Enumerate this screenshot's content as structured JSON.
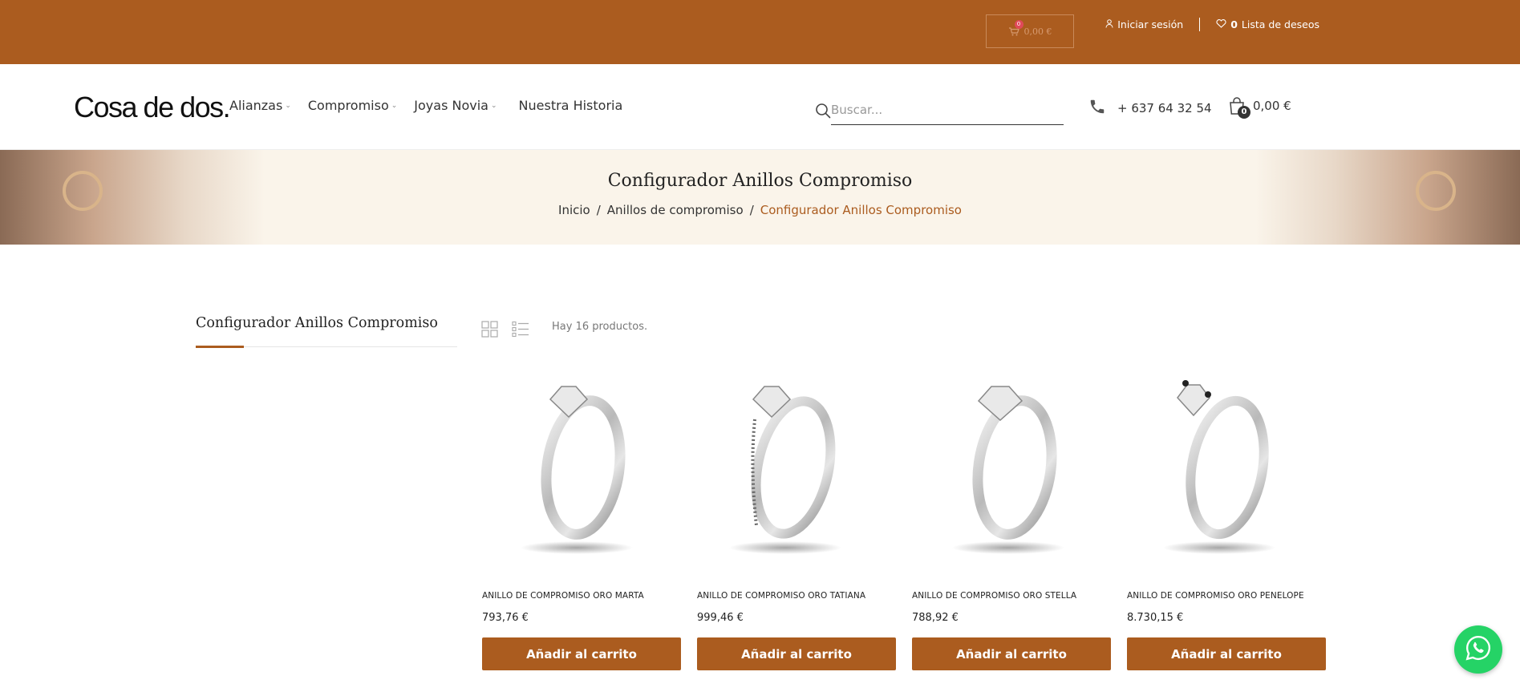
{
  "topbar": {
    "mini_cart_badge": "0",
    "mini_cart_amount": "0,00 €",
    "login_label": "Iniciar sesión",
    "wishlist_count": "0",
    "wishlist_label": "Lista de deseos"
  },
  "header": {
    "logo": "Cosa de dos.",
    "nav": [
      "Alianzas",
      "Compromiso",
      "Joyas Novia",
      "Nuestra Historia"
    ],
    "search_placeholder": "Buscar...",
    "phone": "+ 637 64 32 54",
    "cart_count": "0",
    "cart_amount": "0,00 €"
  },
  "banner": {
    "title": "Configurador Anillos Compromiso",
    "breadcrumb": [
      "Inicio",
      "Anillos de compromiso",
      "Configurador Anillos Compromiso"
    ]
  },
  "sidebar": {
    "title": "Configurador Anillos Compromiso"
  },
  "toolbar": {
    "count_text": "Hay 16 productos."
  },
  "products": [
    {
      "name": "ANILLO DE COMPROMISO ORO MARTA",
      "price": "793,76 €",
      "button": "Añadir al carrito"
    },
    {
      "name": "ANILLO DE COMPROMISO ORO TATIANA",
      "price": "999,46 €",
      "button": "Añadir al carrito"
    },
    {
      "name": "ANILLO DE COMPROMISO ORO STELLA",
      "price": "788,92 €",
      "button": "Añadir al carrito"
    },
    {
      "name": "ANILLO DE COMPROMISO ORO PENELOPE",
      "price": "8.730,15 €",
      "button": "Añadir al carrito"
    }
  ],
  "colors": {
    "brand": "#ab5c1f",
    "banner_bg": "#faf4ea",
    "whatsapp": "#25d366"
  }
}
